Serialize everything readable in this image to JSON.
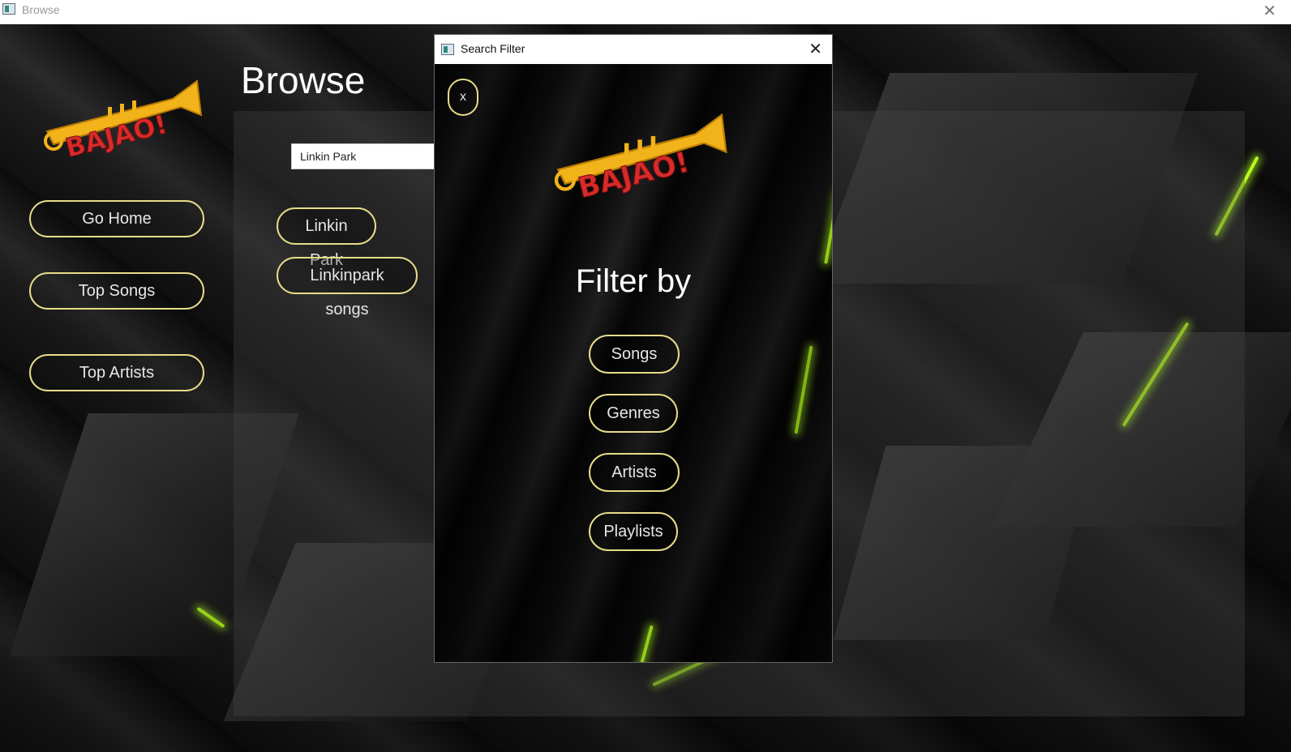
{
  "window": {
    "title": "Browse"
  },
  "logo": {
    "text": "BAJAO!"
  },
  "page": {
    "title": "Browse"
  },
  "sidebar": {
    "items": [
      {
        "label": "Go Home"
      },
      {
        "label": "Top Songs"
      },
      {
        "label": "Top Artists"
      }
    ]
  },
  "search": {
    "value": "Linkin Park"
  },
  "results": [
    {
      "label": "Linkin Park"
    },
    {
      "label": "Linkinpark songs"
    }
  ],
  "dialog": {
    "title": "Search Filter",
    "close_glyph": "✕",
    "x_label": "x",
    "heading": "Filter by",
    "options": [
      {
        "label": "Songs"
      },
      {
        "label": "Genres"
      },
      {
        "label": "Artists"
      },
      {
        "label": "Playlists"
      }
    ]
  },
  "colors": {
    "button_border": "#e8dc8a",
    "accent_glow": "#b7ff1a",
    "logo_red": "#d72b2b",
    "logo_gold": "#f2b21a"
  }
}
